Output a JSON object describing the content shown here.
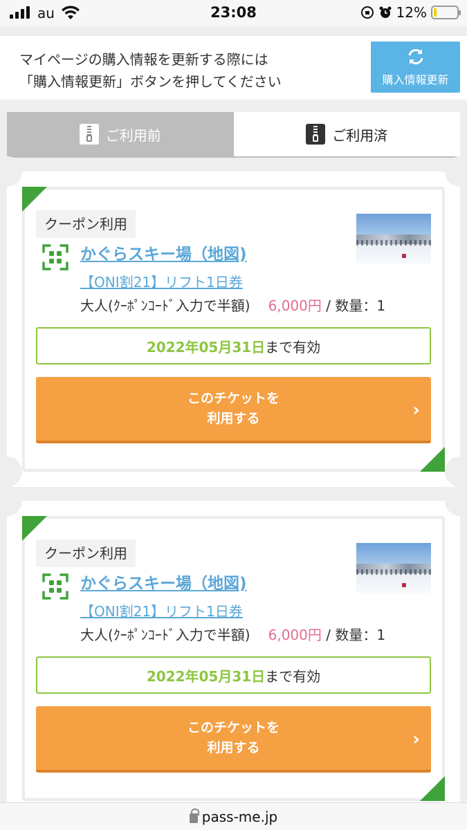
{
  "status_bar": {
    "carrier": "au",
    "time": "23:08",
    "battery": "12%",
    "battery_level": 0.12
  },
  "notice": {
    "line1": "マイページの購入情報を更新する際には",
    "line2": "「購入情報更新」ボタンを押してください",
    "refresh_button": "購入情報更新",
    "refresh_icon": "refresh-icon"
  },
  "tabs": [
    {
      "label": "ご利用前",
      "icon": "zipper-icon",
      "active": true
    },
    {
      "label": "ご利用済",
      "icon": "zipper-icon",
      "active": false
    }
  ],
  "tickets": [
    {
      "tag": "クーポン利用",
      "resort": "かぐらスキー場（地図)",
      "ticket_name": "【ONI割21】リフト1日券",
      "fare": "大人(ｸｰﾎﾟﾝｺｰﾄﾞ入力で半額)",
      "price": "6,000円",
      "quantity": "/ 数量：1",
      "valid_date": "2022年05月31日",
      "valid_suffix": "まで有効",
      "button_line1": "このチケットを",
      "button_line2": "利用する",
      "chevron": "›"
    },
    {
      "tag": "クーポン利用",
      "resort": "かぐらスキー場（地図)",
      "ticket_name": "【ONI割21】リフト1日券",
      "fare": "大人(ｸｰﾎﾟﾝｺｰﾄﾞ入力で半額)",
      "price": "6,000円",
      "quantity": "/ 数量：1",
      "valid_date": "2022年05月31日",
      "valid_suffix": "まで有効",
      "button_line1": "このチケットを",
      "button_line2": "利用する",
      "chevron": "›"
    }
  ],
  "url_bar": {
    "url": "pass-me.jp"
  },
  "colors": {
    "accent_blue": "#5ab4e5",
    "link_blue": "#5aa7d8",
    "green": "#3fa33a",
    "valid_green": "#8dc63f",
    "orange": "#f5a043",
    "price_pink": "#e26d8e"
  }
}
